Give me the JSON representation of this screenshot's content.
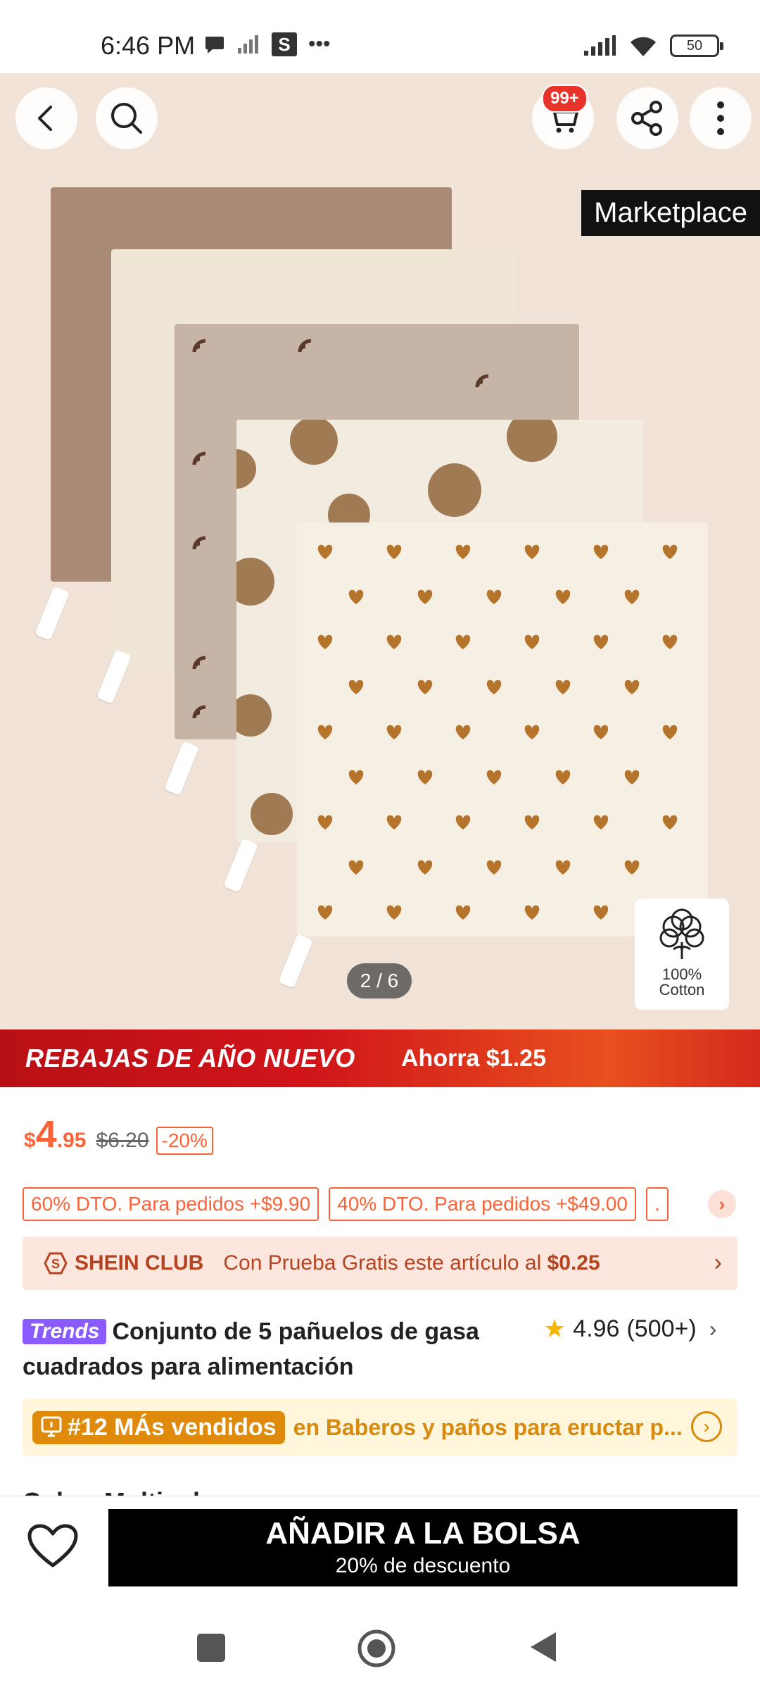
{
  "status_bar": {
    "time": "6:46 PM",
    "battery": "50"
  },
  "hero": {
    "cart_badge": "99+",
    "marketplace_tag": "Marketplace",
    "page_indicator": "2 / 6",
    "cotton_badge": {
      "line1": "100%",
      "line2": "Cotton"
    }
  },
  "sale_banner": {
    "title": "REBAJAS DE AÑO NUEVO",
    "save": "Ahorra $1.25"
  },
  "price": {
    "currency": "$",
    "integer": "4",
    "decimal": ".95",
    "original": "$6.20",
    "discount": "-20%"
  },
  "promos": [
    "60% DTO. Para pedidos +$9.90",
    "40% DTO. Para pedidos +$49.00",
    "."
  ],
  "club": {
    "label": "SHEIN CLUB",
    "text": "Con Prueba Gratis este artículo al ",
    "price": "$0.25"
  },
  "product": {
    "badge": "Trends",
    "title": "Conjunto de 5 pañuelos de gasa cuadrados para alimentación",
    "rating": "4.96",
    "reviews": "(500+)"
  },
  "bestseller": {
    "rank": "#12 MÁs vendidos",
    "category": "en Baberos y paños para eructar p..."
  },
  "color_peek": "Color: Multicolor",
  "action_bar": {
    "add_to_bag": "AÑADIR A LA BOLSA",
    "sub": "20% de descuento"
  }
}
